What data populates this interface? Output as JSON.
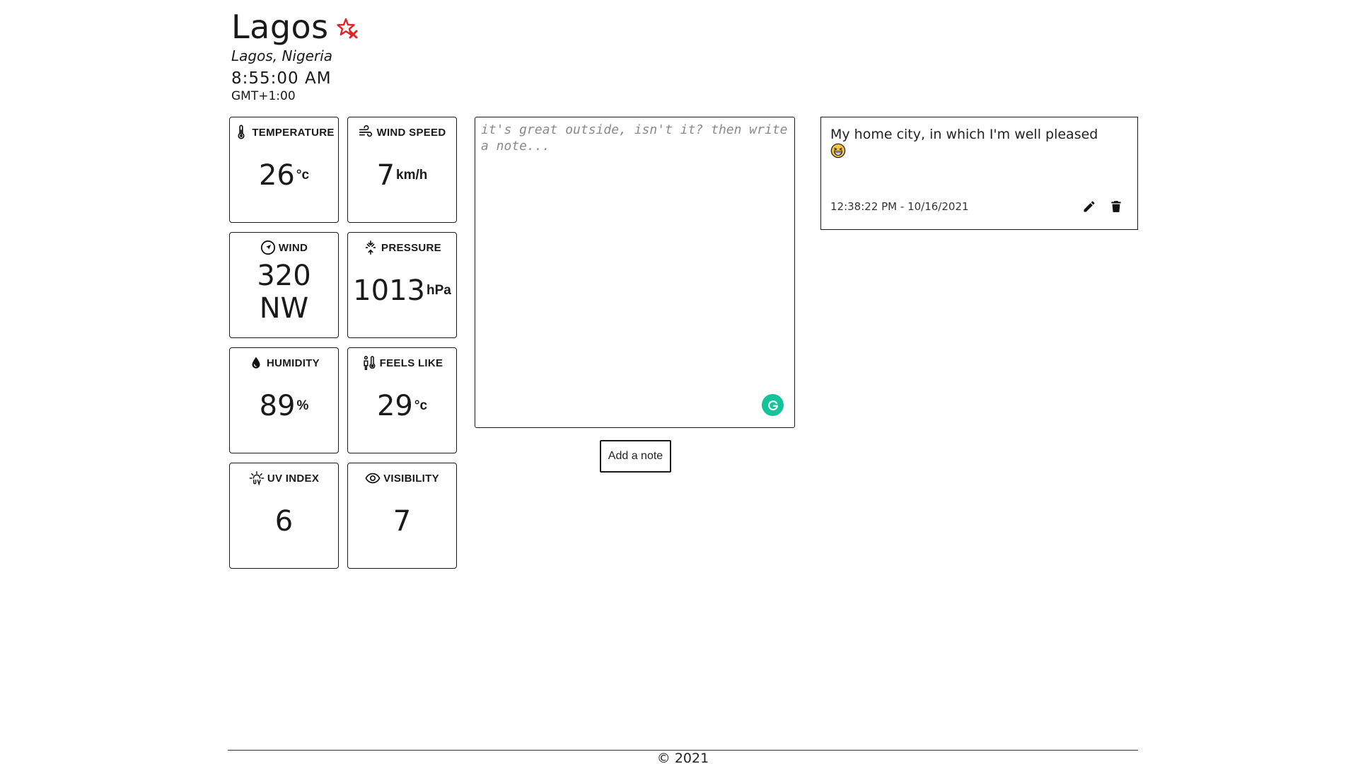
{
  "header": {
    "city": "Lagos",
    "location": "Lagos, Nigeria",
    "time": "8:55:00 AM",
    "timezone": "GMT+1:00",
    "favorite_icon": "star-remove-icon",
    "favorite_color": "#e02424"
  },
  "stats": [
    {
      "label": "TEMPERATURE",
      "value": "26",
      "unit": "°c",
      "icon": "thermometer-icon"
    },
    {
      "label": "WIND SPEED",
      "value": "7",
      "unit": "km/h",
      "icon": "wind-icon"
    },
    {
      "label": "WIND",
      "value": "320",
      "value2": "NW",
      "icon": "compass-icon"
    },
    {
      "label": "PRESSURE",
      "value": "1013",
      "unit": "hPa",
      "icon": "pressure-icon"
    },
    {
      "label": "HUMIDITY",
      "value": "89",
      "unit": "%",
      "icon": "droplet-icon"
    },
    {
      "label": "FEELS LIKE",
      "value": "29",
      "unit": "°c",
      "icon": "feels-like-icon"
    },
    {
      "label": "UV INDEX",
      "value": "6",
      "icon": "uv-sun-icon"
    },
    {
      "label": "VISIBILITY",
      "value": "7",
      "icon": "eye-icon"
    }
  ],
  "note_editor": {
    "placeholder": "it's great outside, isn't it? then write a note...",
    "value": "",
    "add_button_label": "Add a note",
    "grammar_badge_color": "#15c39a"
  },
  "notes": [
    {
      "text": "My home city, in which I'm well pleased",
      "emoji": "grinning-squinting-face-icon",
      "timestamp": "12:38:22 PM - 10/16/2021"
    }
  ],
  "footer": {
    "copyright": "© 2021"
  }
}
